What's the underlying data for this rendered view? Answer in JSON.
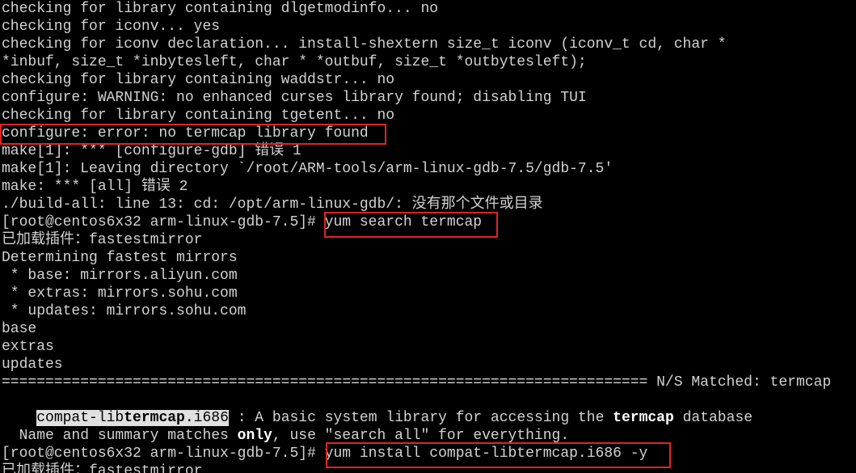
{
  "terminal": {
    "lines": [
      "checking for library containing dlgetmodinfo... no",
      "checking for iconv... yes",
      "checking for iconv declaration... install-shextern size_t iconv (iconv_t cd, char *",
      "*inbuf, size_t *inbytesleft, char * *outbuf, size_t *outbytesleft);",
      "checking for library containing waddstr... no",
      "configure: WARNING: no enhanced curses library found; disabling TUI",
      "checking for library containing tgetent... no",
      "configure: error: no termcap library found",
      "make[1]: *** [configure-gdb] 错误 1",
      "make[1]: Leaving directory `/root/ARM-tools/arm-linux-gdb-7.5/gdb-7.5'",
      "make: *** [all] 错误 2",
      "./build-all: line 13: cd: /opt/arm-linux-gdb/: 没有那个文件或目录",
      "[root@centos6x32 arm-linux-gdb-7.5]# yum search termcap",
      "已加载插件：fastestmirror",
      "Determining fastest mirrors",
      " * base: mirrors.aliyun.com",
      " * extras: mirrors.sohu.com",
      " * updates: mirrors.sohu.com",
      "base",
      "extras",
      "updates",
      "========================================================================== N/S Matched: termcap",
      "",
      "",
      "  Name and summary matches only, use \"search all\" for everything.",
      "[root@centos6x32 arm-linux-gdb-7.5]# yum install compat-libtermcap.i686 -y",
      "已加载插件：fastestmirror"
    ],
    "result": {
      "pkg_pre": "compat-lib",
      "pkg_bold": "termcap",
      "pkg_post": ".i686",
      "sep": " : A basic system library for accessing the ",
      "desc_bold": "termcap",
      "desc_post": " database"
    },
    "colors": {
      "background": "#000000",
      "text": "#d2d2d2",
      "highlight_box": "#e02424"
    }
  }
}
